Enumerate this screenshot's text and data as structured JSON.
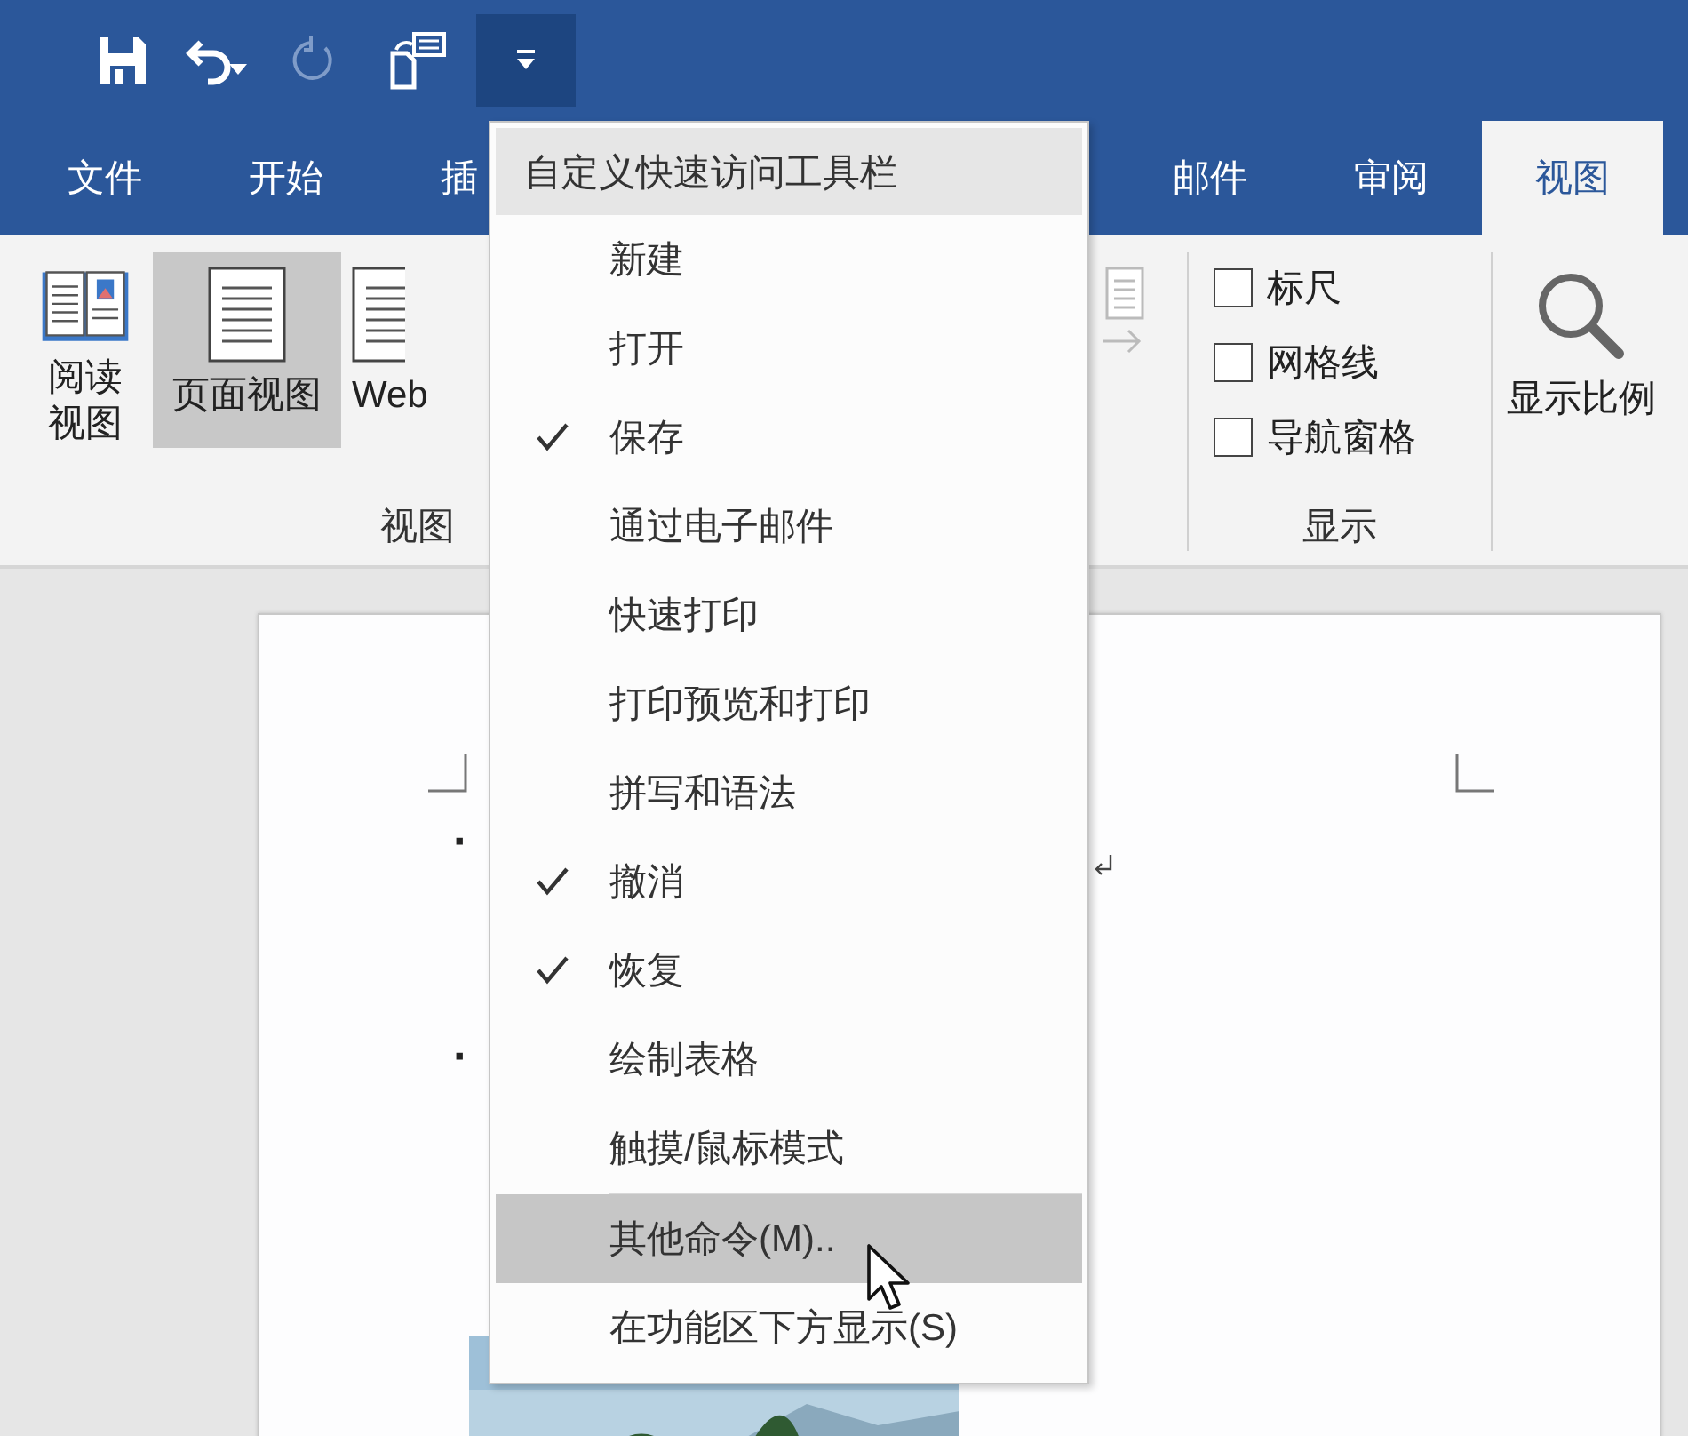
{
  "quick_access": [
    {
      "kind": "save",
      "disabled": false
    },
    {
      "kind": "undo",
      "disabled": false
    },
    {
      "kind": "redo",
      "disabled": true
    },
    {
      "kind": "touch",
      "disabled": false
    }
  ],
  "customize_button": {
    "expanded": true
  },
  "tabs": [
    {
      "label": "文件",
      "selected": false
    },
    {
      "label": "开始",
      "selected": false
    },
    {
      "label": "插",
      "selected": false
    },
    {
      "label": "邮件",
      "selected": false
    },
    {
      "label": "审阅",
      "selected": false
    },
    {
      "label": "视图",
      "selected": true
    }
  ],
  "ribbon": {
    "groups": [
      {
        "label": "视图",
        "controls": [
          {
            "kind": "read",
            "label": "阅读视图",
            "selected": false
          },
          {
            "kind": "page",
            "label": "页面视图",
            "selected": true
          },
          {
            "kind": "web",
            "label": "Web",
            "selected": false
          }
        ]
      },
      {
        "controls": [
          {
            "kind": "flip",
            "disabled": true
          }
        ]
      },
      {
        "label": "显示",
        "controls": [
          {
            "kind": "checkbox",
            "label": "标尺",
            "checked": false
          },
          {
            "kind": "checkbox",
            "label": "网格线",
            "checked": false
          },
          {
            "kind": "checkbox",
            "label": "导航窗格",
            "checked": false
          }
        ]
      },
      {
        "controls": [
          {
            "kind": "zoom",
            "label": "显示比例",
            "selected": false
          }
        ]
      }
    ]
  },
  "document": {
    "bullets": [
      "·",
      "·"
    ],
    "picture": {
      "kind": "picture"
    }
  },
  "menu": {
    "title": "自定义快速访问工具栏",
    "items": [
      {
        "label": "新建",
        "checked": false,
        "selected": false
      },
      {
        "label": "打开",
        "checked": false,
        "selected": false
      },
      {
        "label": "保存",
        "checked": true,
        "selected": false
      },
      {
        "label": "通过电子邮件",
        "checked": false,
        "selected": false
      },
      {
        "label": "快速打印",
        "checked": false,
        "selected": false
      },
      {
        "label": "打印预览和打印",
        "checked": false,
        "selected": false
      },
      {
        "label": "拼写和语法",
        "checked": false,
        "selected": false
      },
      {
        "label": "撤消",
        "checked": true,
        "selected": false
      },
      {
        "label": "恢复",
        "checked": true,
        "selected": false
      },
      {
        "label": "绘制表格",
        "checked": false,
        "selected": false
      },
      {
        "label": "触摸/鼠标模式",
        "checked": false,
        "selected": false
      },
      {
        "label": "其他命令(M)..",
        "checked": false,
        "selected": true,
        "separator_before": true
      },
      {
        "label": "在功能区下方显示(S)",
        "checked": false,
        "selected": false
      }
    ]
  }
}
